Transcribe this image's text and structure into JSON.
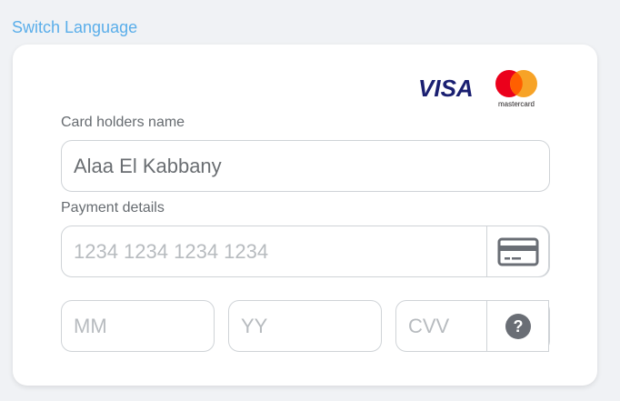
{
  "header": {
    "switch_language_label": "Switch Language"
  },
  "brands": {
    "visa_text": "VISA",
    "mastercard_text": "mastercard",
    "visa_color": "#1a1f71",
    "mastercard_red": "#eb001b",
    "mastercard_orange": "#f79e1b"
  },
  "form": {
    "card_holder_label": "Card holders name",
    "card_holder_value": "Alaa El Kabbany",
    "payment_details_label": "Payment details",
    "card_number_placeholder": "1234 1234 1234 1234",
    "month_placeholder": "MM",
    "year_placeholder": "YY",
    "cvv_placeholder": "CVV",
    "cvv_help_glyph": "?"
  },
  "colors": {
    "accent_link": "#5aaeea",
    "icon_gray": "#6a6e75"
  }
}
